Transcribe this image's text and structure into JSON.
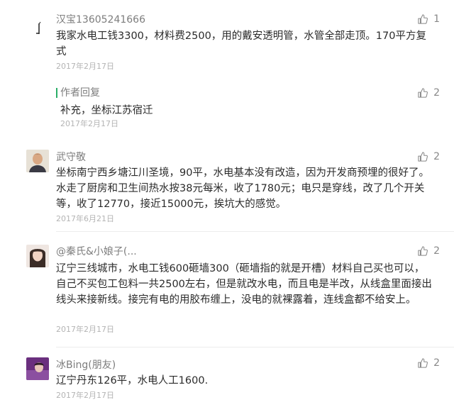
{
  "comments": [
    {
      "author": "汉宝13605241666",
      "text": "我家水电工钱3300，材料费2500，用的戴安透明管，水管全部走顶。170平方复式",
      "date": "2017年2月17日",
      "likes": "1",
      "reply": {
        "label": "作者回复",
        "text": "补充，坐标江苏宿迁",
        "date": "2017年2月17日",
        "likes": "2"
      }
    },
    {
      "author": "武守敬",
      "text": "坐标南宁西乡塘江川圣境，90平，水电基本没有改造，因为开发商预埋的很好了。水走了厨房和卫生间热水按38元每米，收了1780元；电只是穿线，改了几个开关等，收了12770，接近15000元，挨坑大的感觉。",
      "date": "2017年6月21日",
      "likes": "2"
    },
    {
      "author": "@秦氏&小娘子(...",
      "text": "辽宁三线城市，水电工钱600砸墙300（砸墙指的就是开槽）材料自己买也可以，自己不买包工包料一共2500左右，但是就改水电，而且电是半改，从线盒里面接出线头来接新线。接完有电的用胶布缠上，没电的就裸露着，连线盒都不给安上。",
      "date": "2017年2月17日",
      "likes": "2"
    },
    {
      "author": "冰Bing(朋友)",
      "text": "辽宁丹东126平，水电人工1600.",
      "date": "2017年2月17日",
      "likes": "2"
    }
  ],
  "colors": {
    "accent": "#2aae67",
    "meta": "#b4b4b4",
    "text": "#2b2b2b",
    "author": "#7d7d7d"
  }
}
